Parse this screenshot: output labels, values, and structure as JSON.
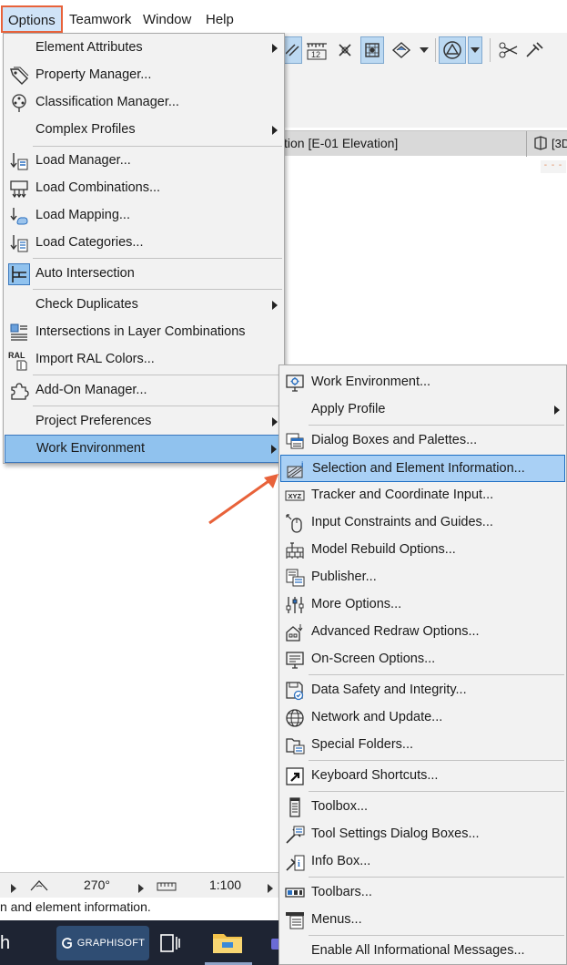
{
  "menubar": {
    "items": [
      "Options",
      "Teamwork",
      "Window",
      "Help"
    ],
    "active": "Options"
  },
  "toolbar": {
    "icons": [
      "diagonal-grid-icon",
      "ruler-icon",
      "intersection-snap-icon",
      "snap-grid-icon",
      "layer-diamond-icon",
      "dropdown-arrow-icon",
      "triangle-circle-icon",
      "dropdown-arrow-icon",
      "scissors-icon",
      "hammer-icon"
    ]
  },
  "tabs": {
    "elevation_tab": "tion [E-01 Elevation]",
    "threed_tab": "[3D"
  },
  "statusbar": {
    "angle": "270°",
    "scale": "1:100"
  },
  "hint_text": "n and element information.",
  "taskbar": {
    "search_fragment": "h",
    "graphisoft_label": "GRAPHISOFT"
  },
  "options_menu": {
    "items": [
      {
        "label": "Element Attributes",
        "icon": "none",
        "submenu": true
      },
      {
        "label": "Property Manager...",
        "icon": "tag-icon",
        "submenu": false
      },
      {
        "label": "Classification Manager...",
        "icon": "tree-hierarchy-icon",
        "submenu": false
      },
      {
        "label": "Complex Profiles",
        "icon": "none",
        "submenu": true
      },
      {
        "label": "Load Manager...",
        "icon": "load-manager-icon",
        "submenu": false
      },
      {
        "label": "Load Combinations...",
        "icon": "load-combinations-icon",
        "submenu": false
      },
      {
        "label": "Load Mapping...",
        "icon": "load-mapping-icon",
        "submenu": false
      },
      {
        "label": "Load Categories...",
        "icon": "load-categories-icon",
        "submenu": false
      },
      {
        "label": "Auto Intersection",
        "icon": "auto-intersection-icon",
        "submenu": false
      },
      {
        "label": "Check Duplicates",
        "icon": "none",
        "submenu": true
      },
      {
        "label": "Intersections in Layer Combinations",
        "icon": "layer-intersection-icon",
        "submenu": false
      },
      {
        "label": "Import RAL Colors...",
        "icon": "ral-icon",
        "submenu": false
      },
      {
        "label": "Add-On Manager...",
        "icon": "puzzle-icon",
        "submenu": false
      },
      {
        "label": "Project Preferences",
        "icon": "none",
        "submenu": true
      },
      {
        "label": "Work Environment",
        "icon": "none",
        "submenu": true
      }
    ]
  },
  "work_env_menu": {
    "items": [
      {
        "label": "Work Environment...",
        "icon": "monitor-gear-icon",
        "submenu": false
      },
      {
        "label": "Apply Profile",
        "icon": "none",
        "submenu": true
      },
      {
        "label": "Dialog Boxes and Palettes...",
        "icon": "dialog-boxes-icon",
        "submenu": false
      },
      {
        "label": "Selection and Element Information...",
        "icon": "selection-info-icon",
        "submenu": false
      },
      {
        "label": "Tracker and Coordinate Input...",
        "icon": "xyz-tracker-icon",
        "submenu": false
      },
      {
        "label": "Input Constraints and Guides...",
        "icon": "mouse-constraint-icon",
        "submenu": false
      },
      {
        "label": "Model Rebuild Options...",
        "icon": "brick-wall-icon",
        "submenu": false
      },
      {
        "label": "Publisher...",
        "icon": "publisher-icon",
        "submenu": false
      },
      {
        "label": "More Options...",
        "icon": "sliders-icon",
        "submenu": false
      },
      {
        "label": "Advanced Redraw Options...",
        "icon": "house-redraw-icon",
        "submenu": false
      },
      {
        "label": "On-Screen Options...",
        "icon": "screen-options-icon",
        "submenu": false
      },
      {
        "label": "Data Safety and Integrity...",
        "icon": "disk-check-icon",
        "submenu": false
      },
      {
        "label": "Network and Update...",
        "icon": "globe-icon",
        "submenu": false
      },
      {
        "label": "Special Folders...",
        "icon": "folder-icon",
        "submenu": false
      },
      {
        "label": "Keyboard Shortcuts...",
        "icon": "shortcut-arrow-icon",
        "submenu": false
      },
      {
        "label": "Toolbox...",
        "icon": "toolbox-icon",
        "submenu": false
      },
      {
        "label": "Tool Settings Dialog Boxes...",
        "icon": "tool-settings-icon",
        "submenu": false
      },
      {
        "label": "Info Box...",
        "icon": "info-box-icon",
        "submenu": false
      },
      {
        "label": "Toolbars...",
        "icon": "toolbars-icon",
        "submenu": false
      },
      {
        "label": "Menus...",
        "icon": "menus-icon",
        "submenu": false
      },
      {
        "label": "Enable All Informational Messages...",
        "icon": "none",
        "submenu": false
      }
    ]
  },
  "colors": {
    "highlight": "#90c2ee",
    "highlight_border": "#3b78bd",
    "callout": "#e8623a",
    "menu_bg": "#f2f2f2"
  }
}
